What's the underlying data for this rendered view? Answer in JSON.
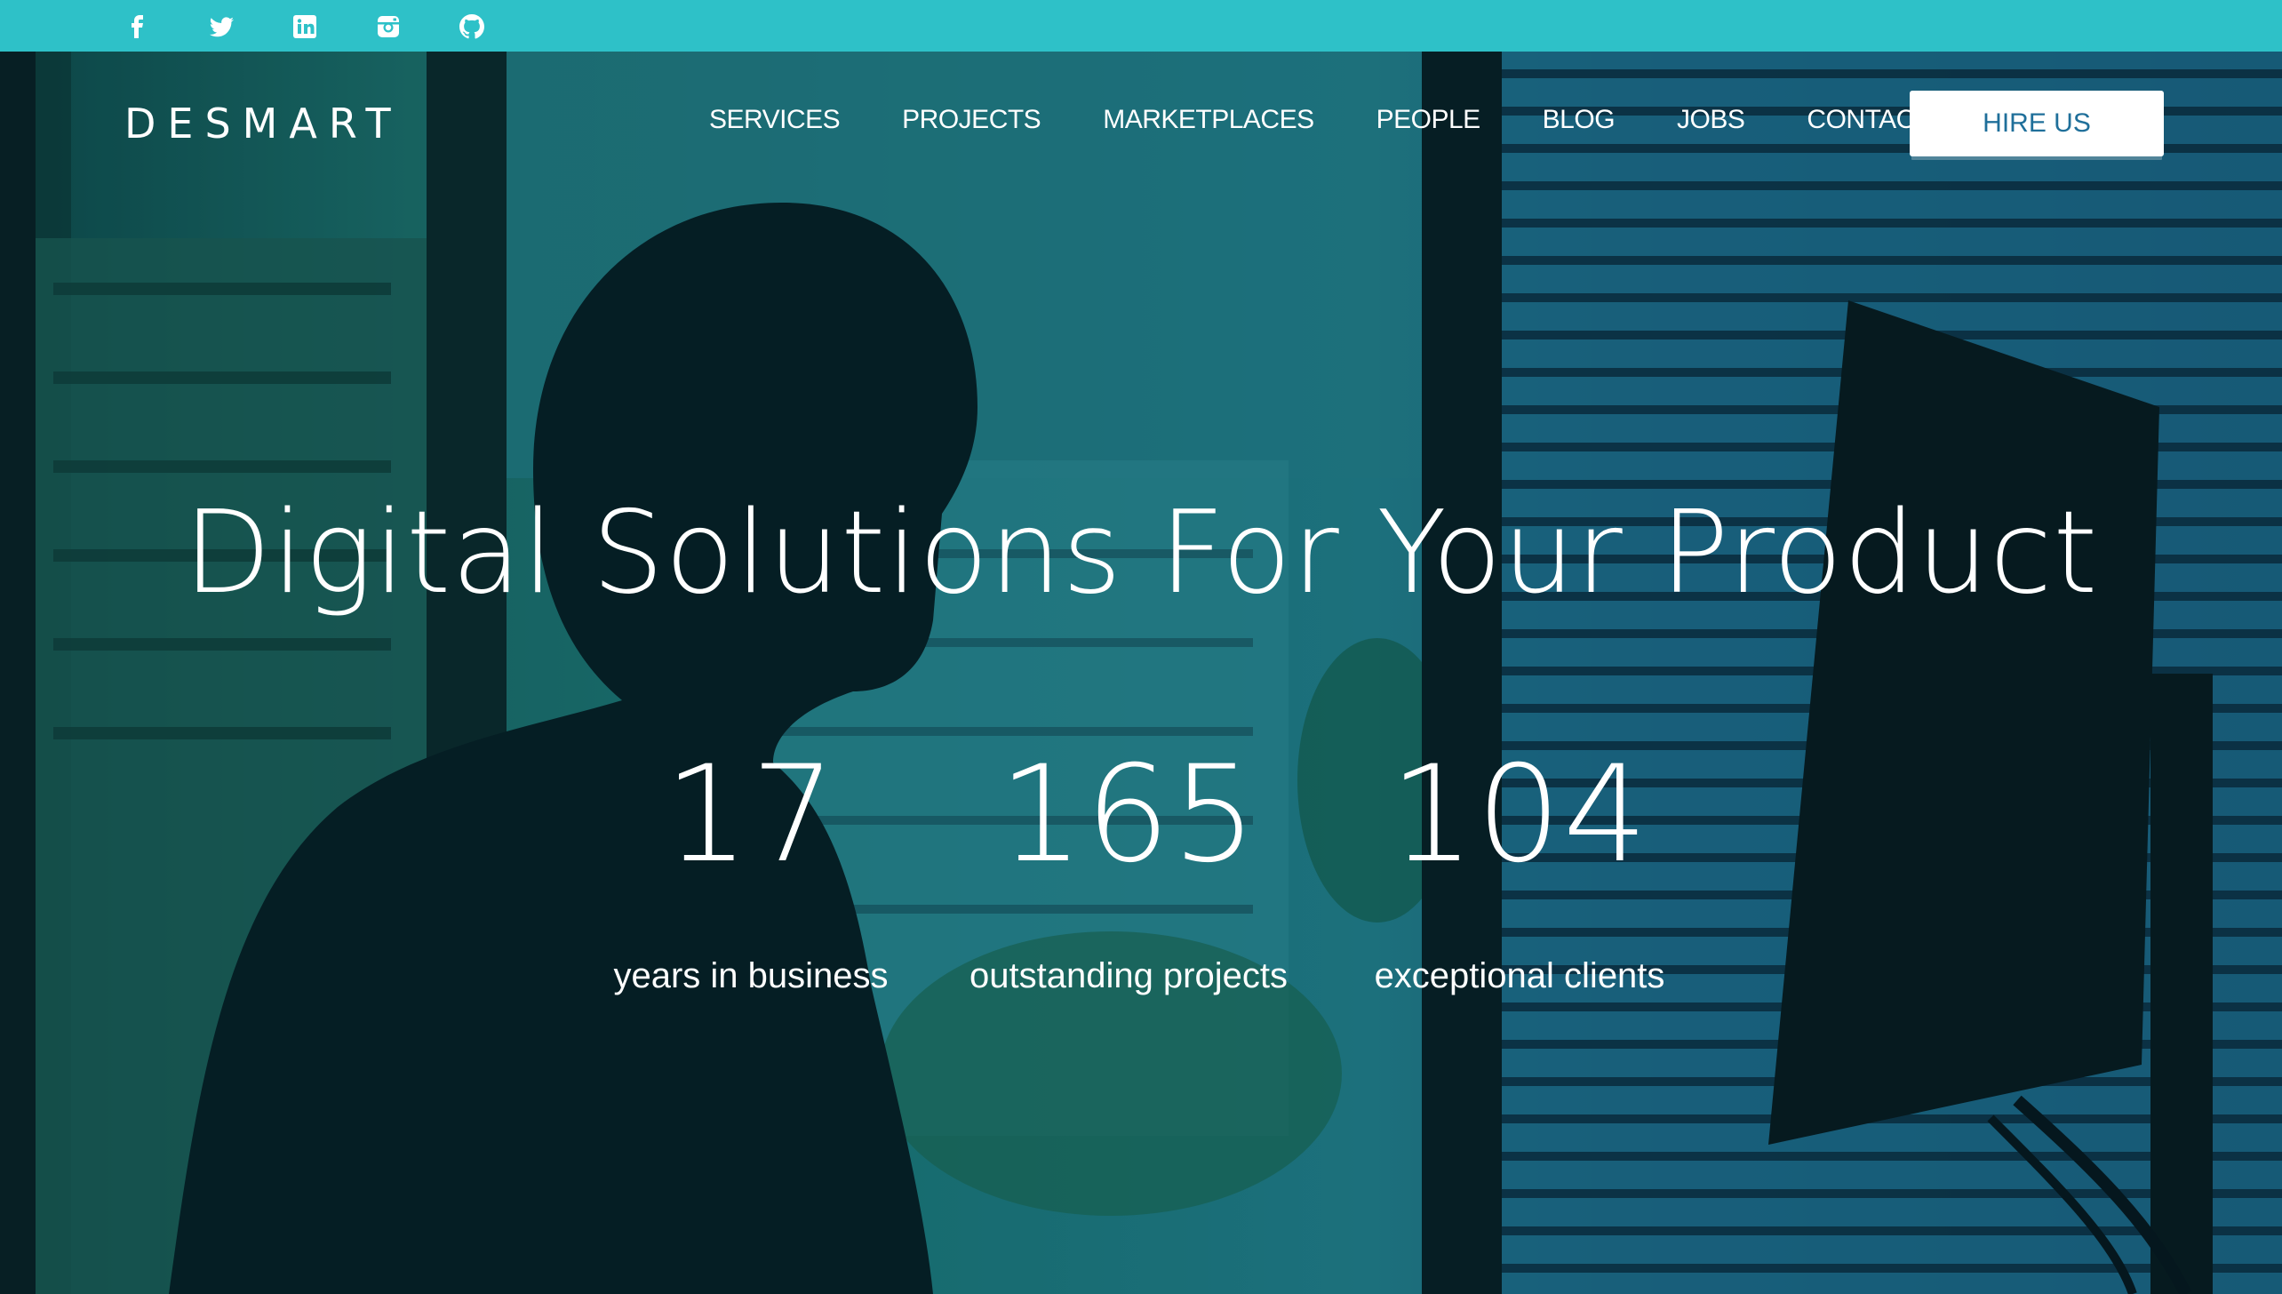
{
  "social_icons": [
    "facebook-icon",
    "twitter-icon",
    "linkedin-icon",
    "instagram-icon",
    "github-icon"
  ],
  "brand": {
    "logo": "DESMART"
  },
  "nav": {
    "items": [
      "SERVICES",
      "PROJECTS",
      "MARKETPLACES",
      "PEOPLE",
      "BLOG",
      "JOBS",
      "CONTACT"
    ],
    "cta": "HIRE US"
  },
  "hero": {
    "headline": "Digital Solutions For Your Product",
    "stats": [
      {
        "value": "17",
        "label": "years in business"
      },
      {
        "value": "165",
        "label": "outstanding projects"
      },
      {
        "value": "104",
        "label": "exceptional clients"
      }
    ]
  },
  "colors": {
    "topbar": "#2ec1c8",
    "cta_text": "#1f6f9a"
  }
}
